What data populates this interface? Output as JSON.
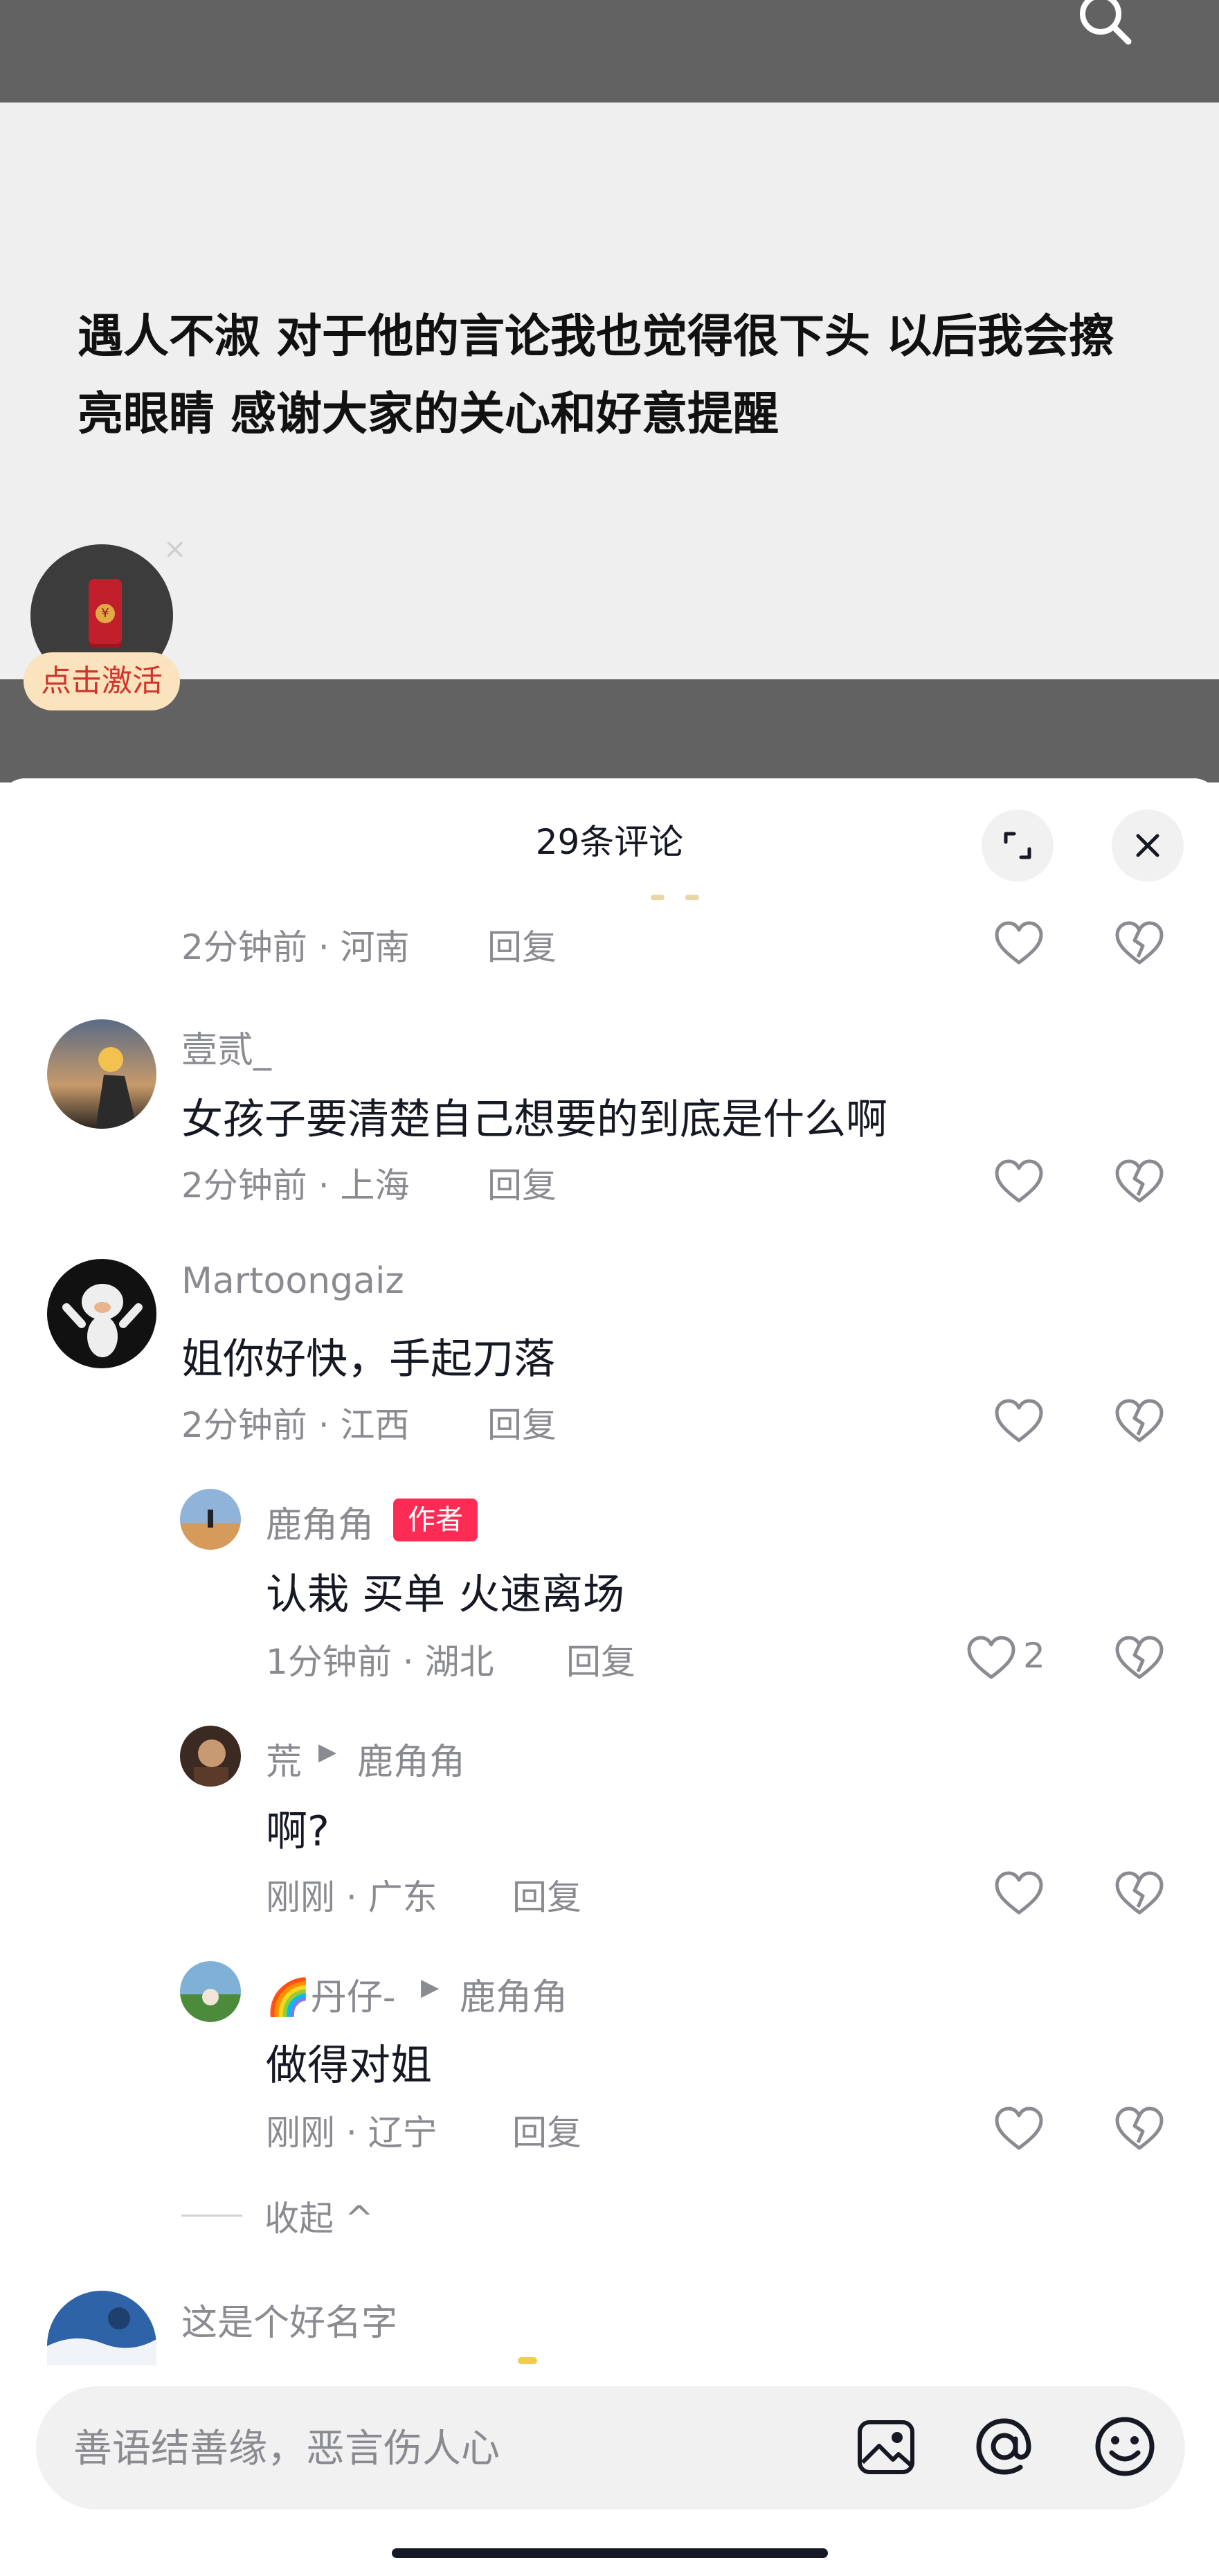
{
  "post": {
    "text": "遇人不淑 对于他的言论我也觉得很下头 以后我会擦亮眼睛 感谢大家的关心和好意提醒"
  },
  "redpack": {
    "coin": "¥",
    "close": "×",
    "badge": "点击激活"
  },
  "sheet": {
    "title": "29条评论"
  },
  "comments": [
    {
      "meta": "2分钟前 · 河南",
      "reply": "回复"
    },
    {
      "name": "壹贰_",
      "text": "女孩子要清楚自己想要的到底是什么啊",
      "meta": "2分钟前 · 上海",
      "reply": "回复"
    },
    {
      "name": "Martoongaiz",
      "text": "姐你好快，手起刀落",
      "meta": "2分钟前 · 江西",
      "reply": "回复",
      "replies": [
        {
          "name": "鹿角角",
          "badge": "作者",
          "text": "认栽 买单 火速离场",
          "meta": "1分钟前 · 湖北",
          "reply": "回复",
          "likes": "2"
        },
        {
          "name": "荒",
          "target": "鹿角角",
          "text": "啊?",
          "meta": "刚刚 · 广东",
          "reply": "回复"
        },
        {
          "name": "🌈丹仔-",
          "target": "鹿角角",
          "text": "做得对姐",
          "meta": "刚刚 · 辽宁",
          "reply": "回复"
        }
      ]
    },
    {
      "name": "这是个好名字"
    }
  ],
  "collapse": {
    "label": "收起 ^"
  },
  "input": {
    "placeholder": "善语结善缘，恶言伤人心"
  },
  "icons": [
    "search-icon",
    "expand-icon",
    "close-icon",
    "heart-icon",
    "broken-heart-icon",
    "image-icon",
    "at-icon",
    "emoji-icon",
    "red-envelope-icon"
  ],
  "colors": {
    "accent": "#fe2c55",
    "muted_text": "#8a8b91",
    "primary_text": "#161823",
    "badge_bg": "#fbe3bd",
    "badge_text": "#d0342c"
  }
}
